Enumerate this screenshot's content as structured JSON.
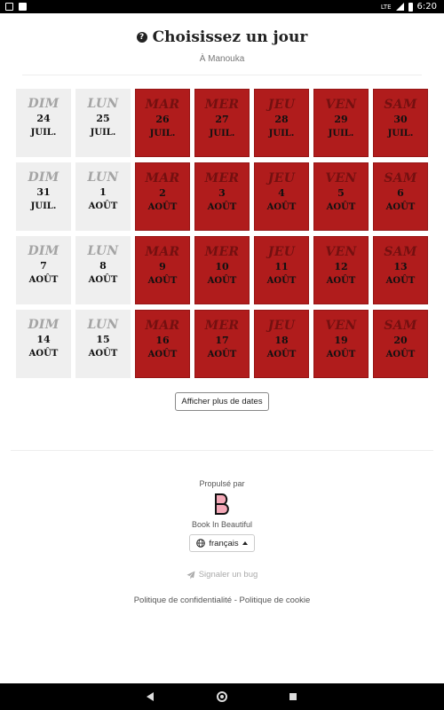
{
  "status_bar": {
    "time": "6:20",
    "icons": [
      "notification-icon",
      "sd-card-icon",
      "lte-icon",
      "signal-icon",
      "battery-icon"
    ]
  },
  "header": {
    "title": "Choisissez un jour",
    "subtitle": "À Manouka",
    "help_icon": "question-circle-icon"
  },
  "calendar": {
    "weeks": [
      [
        {
          "day": "DIM",
          "num": "24",
          "month": "JUIL.",
          "available": false
        },
        {
          "day": "LUN",
          "num": "25",
          "month": "JUIL.",
          "available": false
        },
        {
          "day": "MAR",
          "num": "26",
          "month": "JUIL.",
          "available": true
        },
        {
          "day": "MER",
          "num": "27",
          "month": "JUIL.",
          "available": true
        },
        {
          "day": "JEU",
          "num": "28",
          "month": "JUIL.",
          "available": true
        },
        {
          "day": "VEN",
          "num": "29",
          "month": "JUIL.",
          "available": true
        },
        {
          "day": "SAM",
          "num": "30",
          "month": "JUIL.",
          "available": true
        }
      ],
      [
        {
          "day": "DIM",
          "num": "31",
          "month": "JUIL.",
          "available": false
        },
        {
          "day": "LUN",
          "num": "1",
          "month": "AOÛT",
          "available": false
        },
        {
          "day": "MAR",
          "num": "2",
          "month": "AOÛT",
          "available": true
        },
        {
          "day": "MER",
          "num": "3",
          "month": "AOÛT",
          "available": true
        },
        {
          "day": "JEU",
          "num": "4",
          "month": "AOÛT",
          "available": true
        },
        {
          "day": "VEN",
          "num": "5",
          "month": "AOÛT",
          "available": true
        },
        {
          "day": "SAM",
          "num": "6",
          "month": "AOÛT",
          "available": true
        }
      ],
      [
        {
          "day": "DIM",
          "num": "7",
          "month": "AOÛT",
          "available": false
        },
        {
          "day": "LUN",
          "num": "8",
          "month": "AOÛT",
          "available": false
        },
        {
          "day": "MAR",
          "num": "9",
          "month": "AOÛT",
          "available": true
        },
        {
          "day": "MER",
          "num": "10",
          "month": "AOÛT",
          "available": true
        },
        {
          "day": "JEU",
          "num": "11",
          "month": "AOÛT",
          "available": true
        },
        {
          "day": "VEN",
          "num": "12",
          "month": "AOÛT",
          "available": true
        },
        {
          "day": "SAM",
          "num": "13",
          "month": "AOÛT",
          "available": true
        }
      ],
      [
        {
          "day": "DIM",
          "num": "14",
          "month": "AOÛT",
          "available": false
        },
        {
          "day": "LUN",
          "num": "15",
          "month": "AOÛT",
          "available": false
        },
        {
          "day": "MAR",
          "num": "16",
          "month": "AOÛT",
          "available": true
        },
        {
          "day": "MER",
          "num": "17",
          "month": "AOÛT",
          "available": true
        },
        {
          "day": "JEU",
          "num": "18",
          "month": "AOÛT",
          "available": true
        },
        {
          "day": "VEN",
          "num": "19",
          "month": "AOÛT",
          "available": true
        },
        {
          "day": "SAM",
          "num": "20",
          "month": "AOÛT",
          "available": true
        }
      ]
    ],
    "more_dates_label": "Afficher plus de dates"
  },
  "footer": {
    "powered_by": "Propulsé par",
    "brand": "Book In Beautiful",
    "logo_icon": "bib-logo",
    "language": "français",
    "report_bug": "Signaler un bug",
    "privacy_policy": "Politique de confidentialité",
    "separator": " - ",
    "cookie_policy": "Politique de cookie"
  },
  "colors": {
    "available": "#b01c1c",
    "unavailable": "#efefef",
    "available_dayname": "#741010",
    "unavailable_dayname": "#a4a4a4"
  }
}
